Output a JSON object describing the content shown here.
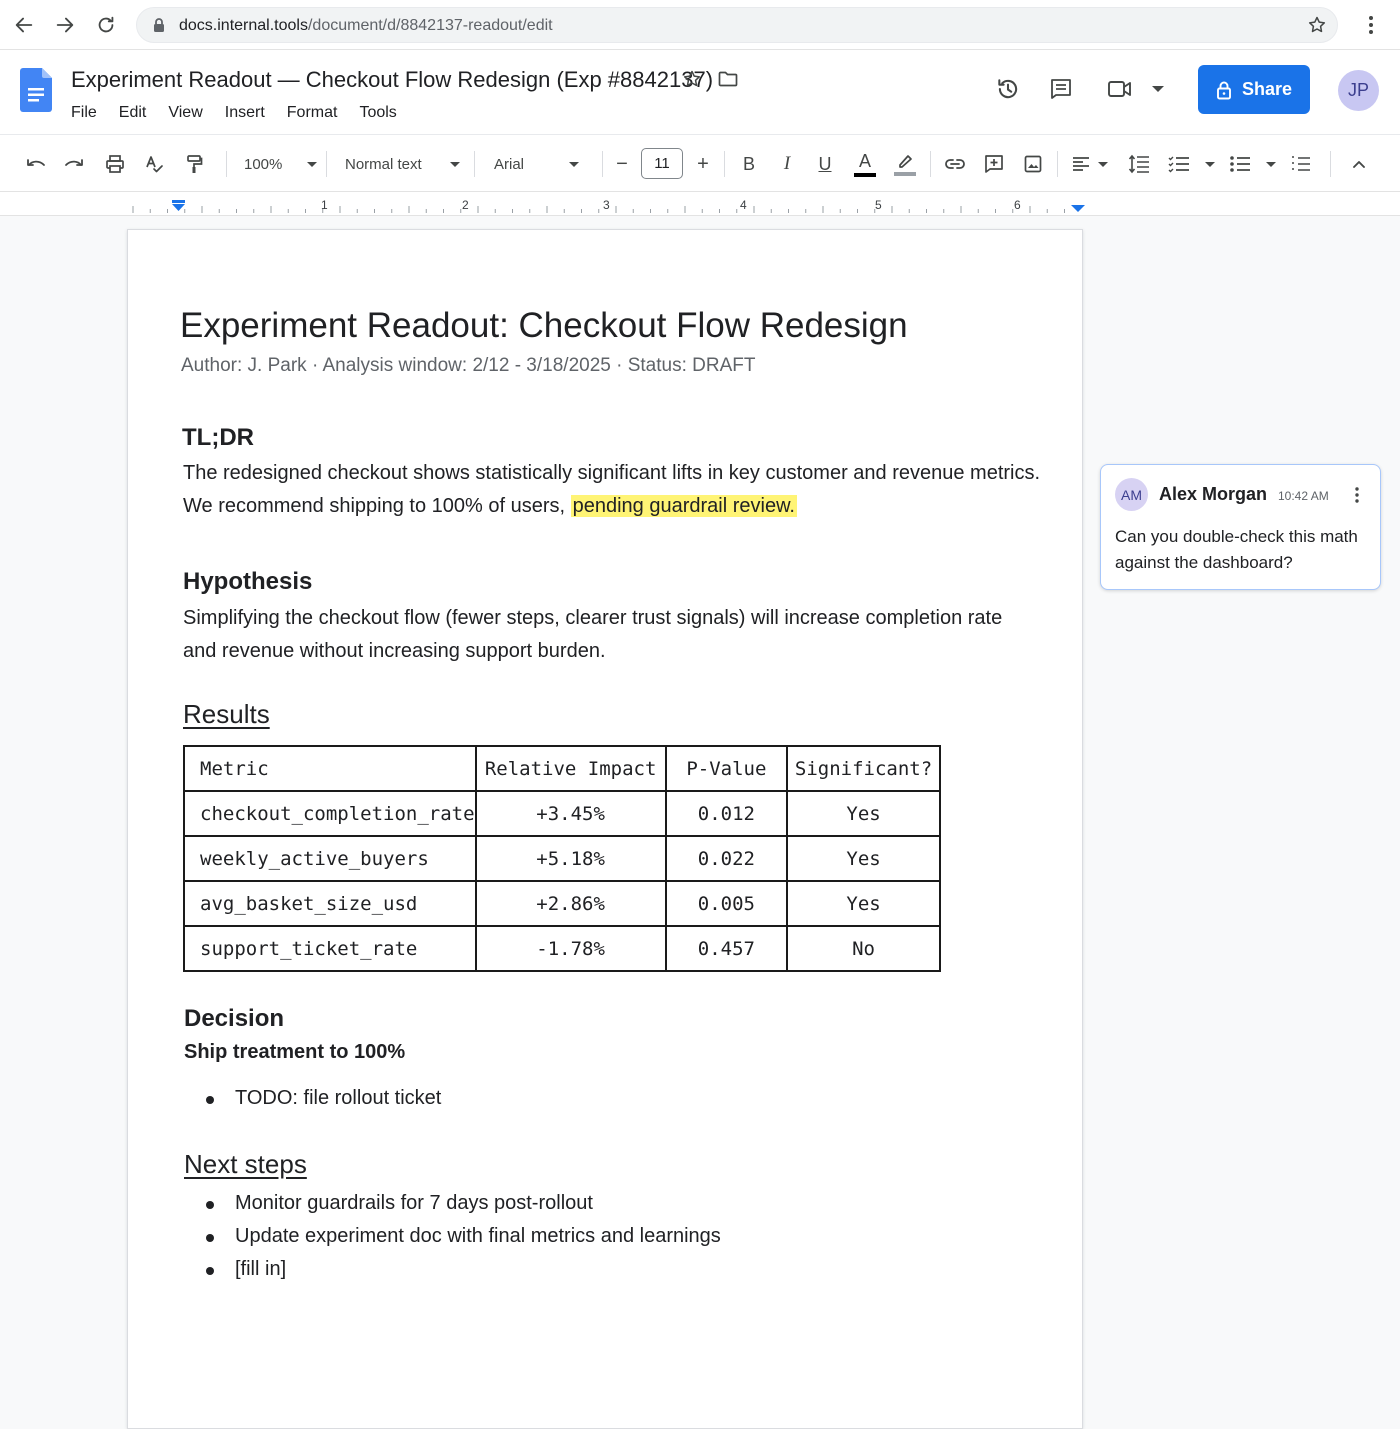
{
  "browser": {
    "url_host": "docs.internal.tools",
    "url_path": "/document/d/8842137-readout/edit"
  },
  "header": {
    "doc_title": "Experiment Readout — Checkout Flow Redesign (Exp #8842137)",
    "menu": [
      "File",
      "Edit",
      "View",
      "Insert",
      "Format",
      "Tools"
    ],
    "share_label": "Share",
    "user_initials": "JP"
  },
  "toolbar": {
    "zoom": "100%",
    "style": "Normal text",
    "font": "Arial",
    "font_size": "11",
    "bold_label": "B",
    "italic_label": "I",
    "underline_label": "U",
    "text_color_label": "A",
    "minus_label": "−",
    "plus_label": "+"
  },
  "ruler": {
    "numbers": [
      "1",
      "2",
      "3",
      "4",
      "5",
      "6"
    ]
  },
  "document": {
    "title": "Experiment Readout: Checkout Flow Redesign",
    "meta": "Author: J. Park · Analysis window: 2/12 - 3/18/2025 · Status: DRAFT",
    "tldr_heading": "TL;DR",
    "tldr_line1": "The redesigned checkout shows statistically significant lifts in key customer and revenue metrics.",
    "tldr_line2_start": "We recommend shipping to 100% of users, ",
    "tldr_highlight": "pending guardrail review.",
    "hypothesis_heading": "Hypothesis",
    "hypothesis_line1": "Simplifying the checkout flow (fewer steps, clearer trust signals) will increase completion rate",
    "hypothesis_line2": "and revenue without increasing support burden.",
    "results_heading": "Results",
    "table": {
      "headers": [
        "Metric",
        "Relative Impact",
        "P-Value",
        "Significant?"
      ],
      "rows": [
        [
          "checkout_completion_rate",
          "+3.45%",
          "0.012",
          "Yes"
        ],
        [
          "weekly_active_buyers",
          "+5.18%",
          "0.022",
          "Yes"
        ],
        [
          "avg_basket_size_usd",
          "+2.86%",
          "0.005",
          "Yes"
        ],
        [
          "support_ticket_rate",
          "-1.78%",
          "0.457",
          "No"
        ]
      ]
    },
    "decision_heading": "Decision",
    "decision_sub": "Ship treatment to 100%",
    "decision_bullets": [
      "TODO: file rollout ticket"
    ],
    "todo_color": "#d93025",
    "next_steps_heading": "Next steps",
    "next_steps": [
      "Monitor guardrails for 7 days post-rollout",
      "Update experiment doc with final metrics and learnings",
      "[fill in]"
    ]
  },
  "comment": {
    "initials": "AM",
    "author": "Alex Morgan",
    "time": "10:42 AM",
    "text": "Can you double-check this math against the dashboard?"
  },
  "colors": {
    "accent": "#1a73e8",
    "highlight": "#fff475"
  }
}
